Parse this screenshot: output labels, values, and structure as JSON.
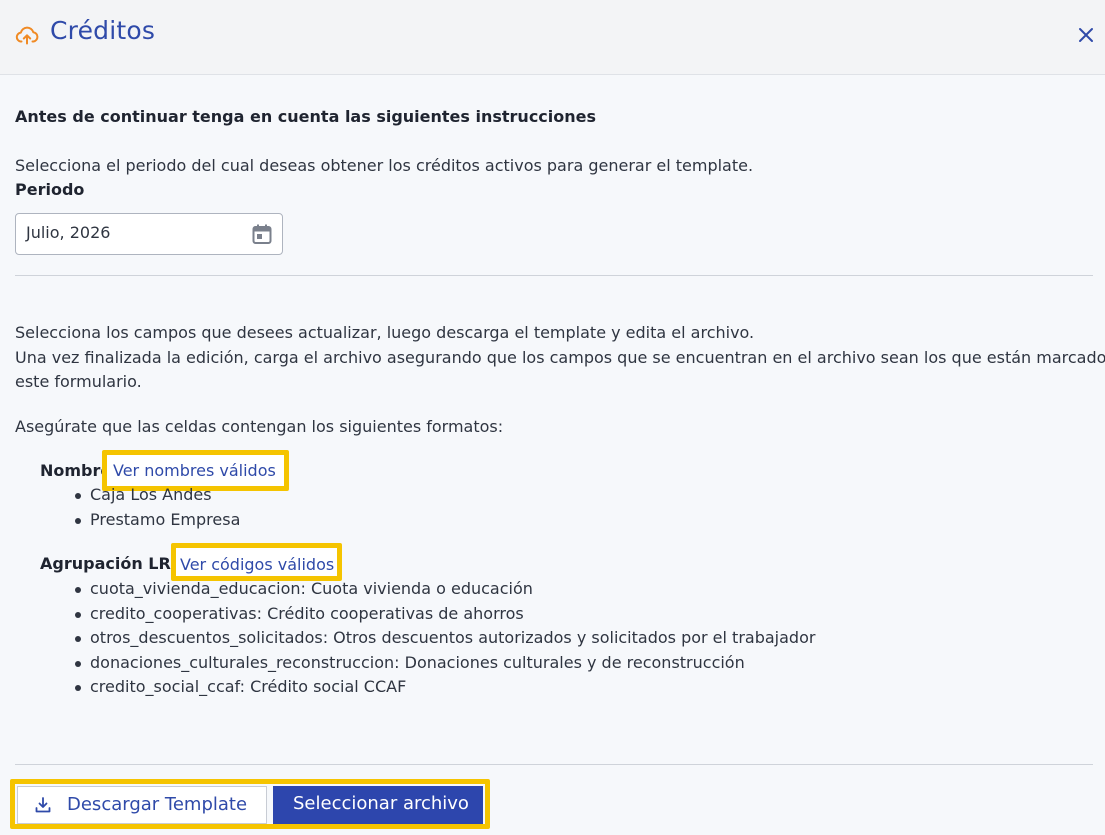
{
  "header": {
    "title": "Créditos",
    "icon": "cloud-upload-icon",
    "close_icon": "close-icon"
  },
  "instructions": {
    "heading": "Antes de continuar tenga en cuenta las siguientes instrucciones",
    "period_help": "Selecciona el periodo del cual deseas obtener los créditos activos para generar el template.",
    "period_label": "Periodo",
    "period_value": "Julio, 2026",
    "fields_line1": "Selecciona los campos que desees actualizar, luego descarga el template y edita el archivo.",
    "fields_line2": "Una vez finalizada la edición, carga el archivo asegurando que los campos que se encuentran en el archivo sean los que están marcados en",
    "fields_line3": "este formulario.",
    "formats_intro": "Asegúrate que las celdas contengan los siguientes formatos:"
  },
  "nombre": {
    "label": "Nombre",
    "link": "Ver nombres válidos",
    "items": [
      "Caja Los Andes",
      "Prestamo Empresa"
    ]
  },
  "agrupacion": {
    "label": "Agrupación LRE",
    "link": "Ver códigos válidos",
    "items": [
      "cuota_vivienda_educacion: Cuota vivienda o educación",
      "credito_cooperativas: Crédito cooperativas de ahorros",
      "otros_descuentos_solicitados: Otros descuentos autorizados y solicitados por el trabajador",
      "donaciones_culturales_reconstruccion: Donaciones culturales y de reconstrucción",
      "credito_social_ccaf: Crédito social CCAF"
    ]
  },
  "footer": {
    "download_label": "Descargar Template",
    "select_label": "Seleccionar archivo"
  },
  "colors": {
    "accent": "#2f4aa9",
    "highlight": "#f5c400",
    "icon_orange": "#f08a24"
  }
}
